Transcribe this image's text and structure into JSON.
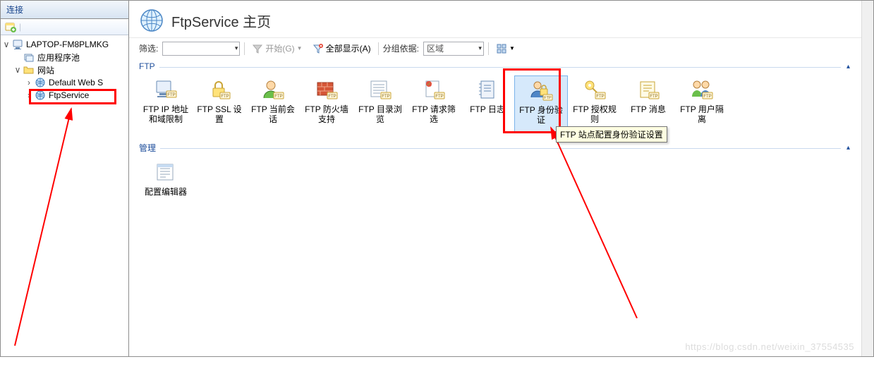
{
  "left": {
    "header": "连接",
    "tree": {
      "root": "LAPTOP-FM8PLMKG",
      "apppool": "应用程序池",
      "sites": "网站",
      "default": "Default Web S",
      "ftpservice": "FtpService"
    }
  },
  "header": {
    "title": "FtpService 主页"
  },
  "filter": {
    "label": "筛选:",
    "start": "开始(G)",
    "showall": "全部显示(A)",
    "groupby": "分组依据:",
    "groupval": "区域"
  },
  "groups": {
    "ftp": {
      "title": "FTP",
      "items": [
        {
          "label": "FTP IP 地址和域限制"
        },
        {
          "label": "FTP SSL 设置"
        },
        {
          "label": "FTP 当前会话"
        },
        {
          "label": "FTP 防火墙支持"
        },
        {
          "label": "FTP 目录浏览"
        },
        {
          "label": "FTP 请求筛选"
        },
        {
          "label": "FTP 日志"
        },
        {
          "label": "FTP 身份验证"
        },
        {
          "label": "FTP 授权规则"
        },
        {
          "label": "FTP 消息"
        },
        {
          "label": "FTP 用户隔离"
        }
      ]
    },
    "mgmt": {
      "title": "管理",
      "items": [
        {
          "label": "配置编辑器"
        }
      ]
    }
  },
  "tooltip": "FTP 站点配置身份验证设置",
  "watermark": "https://blog.csdn.net/weixin_37554535"
}
